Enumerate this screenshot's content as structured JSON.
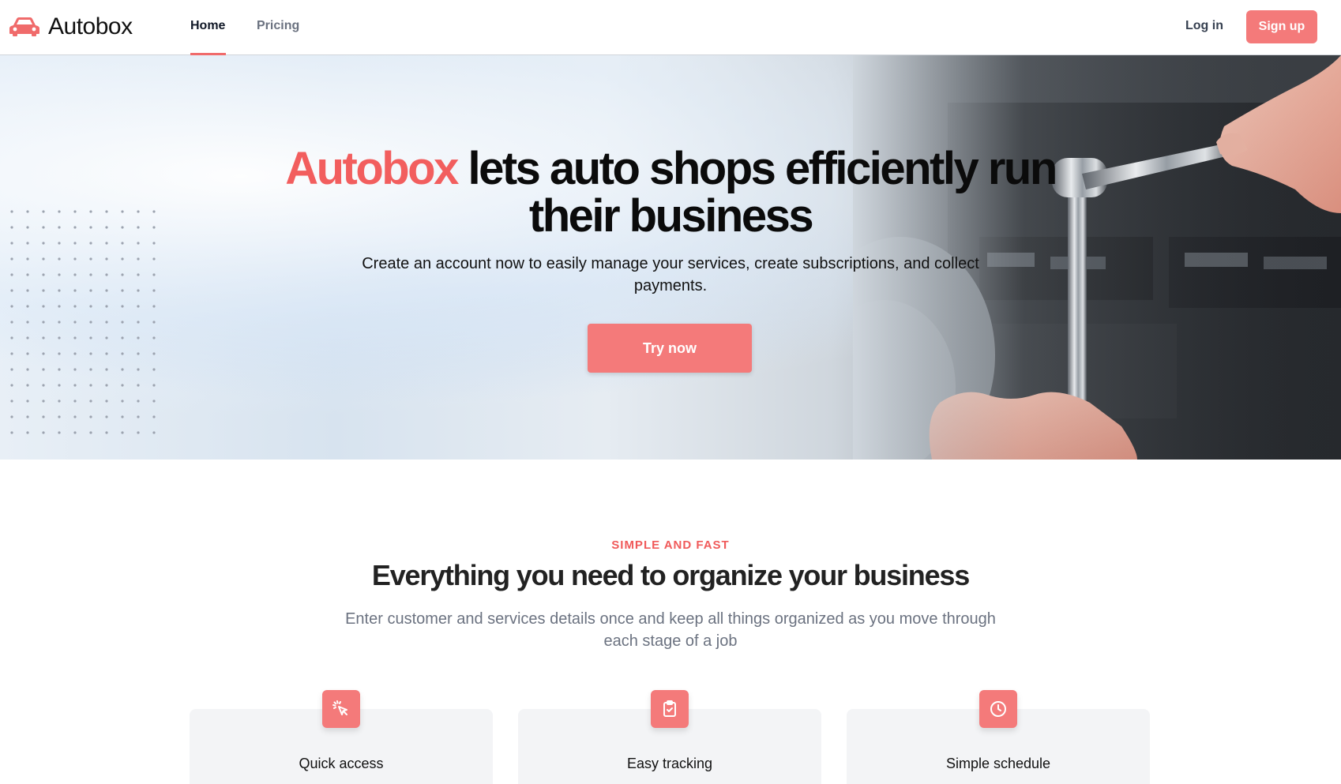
{
  "nav": {
    "brand": "Autobox",
    "links": [
      {
        "label": "Home",
        "active": true
      },
      {
        "label": "Pricing",
        "active": false
      }
    ],
    "login_label": "Log in",
    "signup_label": "Sign up",
    "accent_color": "#f47a7a"
  },
  "hero": {
    "title_brand": "Autobox",
    "title_rest": "lets auto shops efficiently run their business",
    "subtitle": "Create an account now to easily manage your services, create subscriptions, and collect payments.",
    "cta_label": "Try now"
  },
  "features": {
    "eyebrow": "SIMPLE AND FAST",
    "title": "Everything you need to organize your business",
    "subtitle": "Enter customer and services details once and keep all things organized as you move through each stage of a job",
    "cards": [
      {
        "icon": "cursor-click-icon",
        "title": "Quick access"
      },
      {
        "icon": "clipboard-check-icon",
        "title": "Easy tracking"
      },
      {
        "icon": "clock-icon",
        "title": "Simple schedule"
      }
    ]
  }
}
